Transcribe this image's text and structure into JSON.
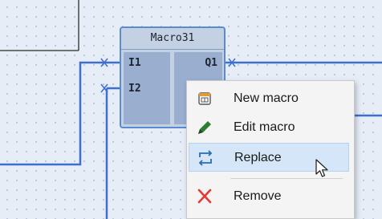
{
  "diagram": {
    "macro_block": {
      "title": "Macro31",
      "inputs": [
        "I1",
        "I2"
      ],
      "outputs": [
        "Q1"
      ]
    }
  },
  "context_menu": {
    "items": [
      {
        "label": "New macro",
        "icon": "new-macro-icon"
      },
      {
        "label": "Edit macro",
        "icon": "pencil-icon"
      },
      {
        "label": "Replace",
        "icon": "replace-arrows-icon",
        "hovered": true
      },
      {
        "label": "Remove",
        "icon": "red-x-icon"
      }
    ]
  },
  "colors": {
    "canvas": "#e6edf7",
    "wire": "#3d6fd0",
    "block_border": "#5b8bd0",
    "block_fill": "#c4d1e3",
    "pin_area": "#9aaed0",
    "menu_hover": "#d4e6f7",
    "remove_icon": "#e53935",
    "edit_icon": "#2e7d32"
  }
}
